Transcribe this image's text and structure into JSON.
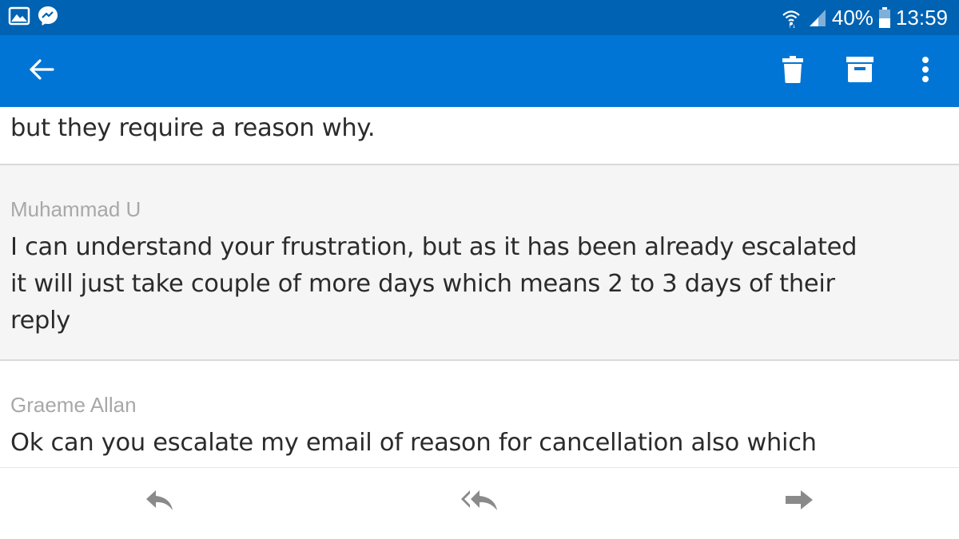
{
  "status_bar": {
    "notification_icons": [
      "gallery-icon",
      "messenger-icon"
    ],
    "battery_percent": "40%",
    "time": "13:59"
  },
  "app_bar": {
    "icons": [
      "back-arrow-icon",
      "trash-icon",
      "archive-icon",
      "more-vert-icon"
    ],
    "accent_color": "#0075d6"
  },
  "messages": [
    {
      "sender": "",
      "lines": [
        "but they require a reason why."
      ]
    },
    {
      "sender": "Muhammad U",
      "lines": [
        "I can understand your frustration, but as it has been already escalated",
        "it will just take couple of more days which means 2 to 3 days of their",
        "reply"
      ]
    },
    {
      "sender": "Graeme Allan",
      "lines": [
        "Ok can you escalate my email of reason for cancellation also which"
      ]
    }
  ],
  "bottom_bar": {
    "icons": [
      "reply-icon",
      "reply-all-icon",
      "forward-icon"
    ]
  }
}
